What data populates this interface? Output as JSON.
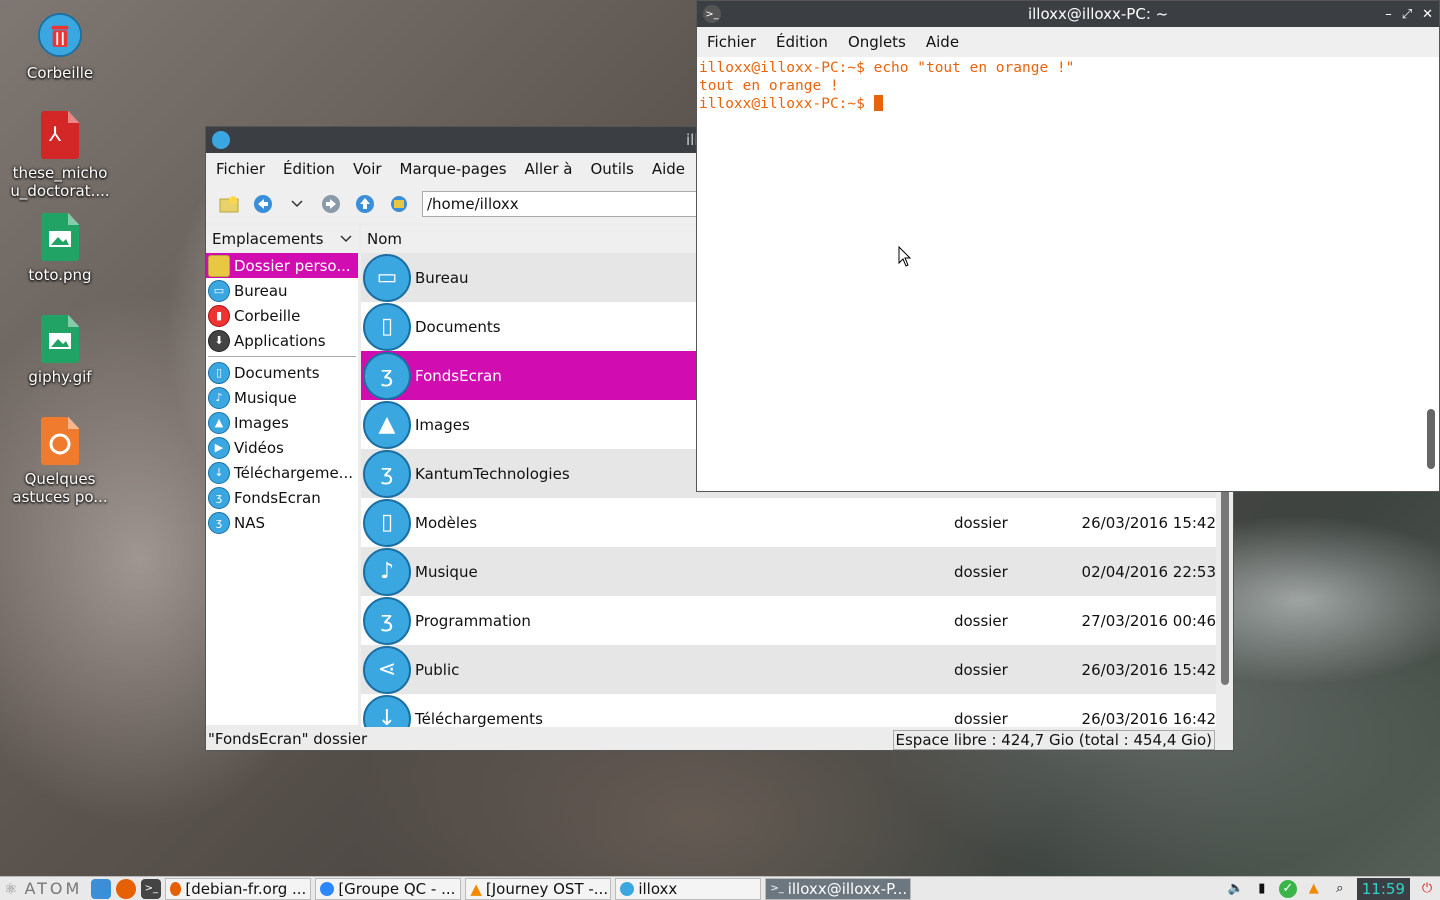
{
  "desktop": {
    "icons": [
      {
        "label": "Corbeille"
      },
      {
        "label": "these_micho u_doctorat...."
      },
      {
        "label": "toto.png"
      },
      {
        "label": "giphy.gif"
      },
      {
        "label": "Quelques astuces po..."
      }
    ]
  },
  "file_manager": {
    "title": "illo",
    "menu": [
      "Fichier",
      "Édition",
      "Voir",
      "Marque-pages",
      "Aller à",
      "Outils",
      "Aide"
    ],
    "path": "/home/illoxx",
    "sidebar": {
      "header": "Emplacements",
      "items": [
        "Dossier perso...",
        "Bureau",
        "Corbeille",
        "Applications"
      ],
      "bookmarks": [
        "Documents",
        "Musique",
        "Images",
        "Vidéos",
        "Téléchargeme...",
        "FondsEcran",
        "NAS"
      ]
    },
    "list": {
      "col_name": "Nom",
      "rows": [
        {
          "name": "Bureau",
          "type": "",
          "date": ""
        },
        {
          "name": "Documents",
          "type": "",
          "date": ""
        },
        {
          "name": "FondsEcran",
          "type": "",
          "date": ""
        },
        {
          "name": "Images",
          "type": "",
          "date": ""
        },
        {
          "name": "KantumTechnologies",
          "type": "",
          "date": ""
        },
        {
          "name": "Modèles",
          "type": "dossier",
          "date": "26/03/2016 15:42"
        },
        {
          "name": "Musique",
          "type": "dossier",
          "date": "02/04/2016 22:53"
        },
        {
          "name": "Programmation",
          "type": "dossier",
          "date": "27/03/2016 00:46"
        },
        {
          "name": "Public",
          "type": "dossier",
          "date": "26/03/2016 15:42"
        },
        {
          "name": "Téléchargements",
          "type": "dossier",
          "date": "26/03/2016 16:42"
        }
      ]
    },
    "status_left": "\"FondsEcran\" dossier",
    "status_right": "Espace libre : 424,7 Gio (total : 454,4 Gio)"
  },
  "terminal": {
    "title": "illoxx@illoxx-PC: ~",
    "menu": [
      "Fichier",
      "Édition",
      "Onglets",
      "Aide"
    ],
    "lines": [
      "illoxx@illoxx-PC:~$ echo \"tout en orange !\"",
      "tout en orange !",
      "illoxx@illoxx-PC:~$ "
    ],
    "text_color": "#e8640c"
  },
  "taskbar": {
    "start_label": "ATOM",
    "tasks": [
      "[debian-fr.org ...",
      "[Groupe QC - ...",
      "[Journey OST -...",
      "illoxx",
      "illoxx@illoxx-P..."
    ],
    "clock": "11:59"
  },
  "colors": {
    "selection": "#d10cb0",
    "folder_icon": "#3ba7e0",
    "clock_text": "#2fd3c7"
  }
}
